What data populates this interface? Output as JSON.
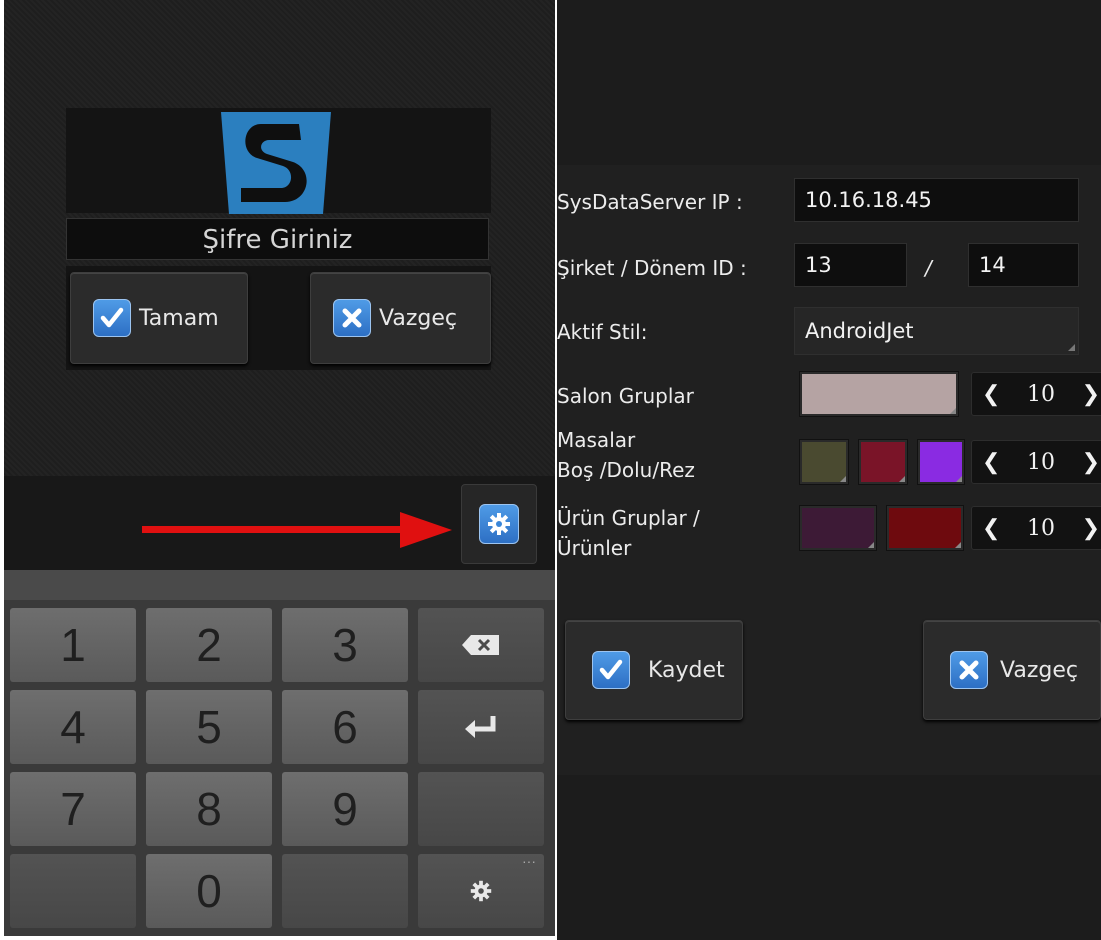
{
  "login": {
    "password_placeholder": "Şifre Giriniz",
    "ok_label": "Tamam",
    "cancel_label": "Vazgeç"
  },
  "keypad": {
    "keys": [
      "1",
      "2",
      "3",
      "4",
      "5",
      "6",
      "7",
      "8",
      "9",
      "0"
    ]
  },
  "settings": {
    "server_ip_label": "SysDataServer IP :",
    "server_ip_value": "10.16.18.45",
    "company_period_label": "Şirket / Dönem ID :",
    "company_id_value": "13",
    "separator": "/",
    "period_id_value": "14",
    "active_style_label": "Aktif Stil:",
    "active_style_value": "AndroidJet",
    "hall_groups_label": "Salon Gruplar",
    "hall_groups_size": "10",
    "tables_label_line1": "Masalar",
    "tables_label_line2": "Boş /Dolu/Rez",
    "tables_size": "10",
    "product_groups_label_line1": "Ürün Gruplar /",
    "product_groups_label_line2": "Ürünler",
    "product_groups_size": "10",
    "save_label": "Kaydet",
    "cancel_label": "Vazgeç"
  },
  "colors": {
    "accent_blue": "#3a86d8",
    "hall_groups_color": "#b5a3a3",
    "table_empty_color": "#4a4a30",
    "table_full_color": "#7a1428",
    "table_reserved_color": "#8a2be2",
    "product_group_color": "#3d1a36",
    "product_color": "#6e0a0e",
    "arrow_red": "#e01010"
  }
}
